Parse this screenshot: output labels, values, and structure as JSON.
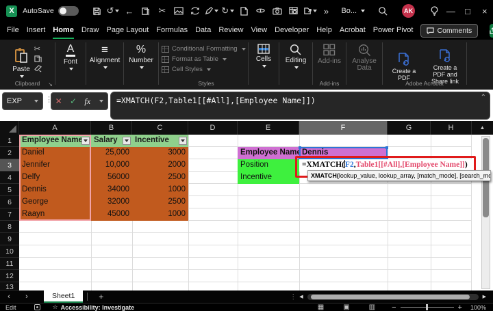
{
  "titlebar": {
    "autosave_label": "AutoSave",
    "doc_title": "Bo...",
    "avatar_initials": "AK"
  },
  "ribbon_tabs": {
    "items": [
      {
        "label": "File"
      },
      {
        "label": "Insert"
      },
      {
        "label": "Home"
      },
      {
        "label": "Draw"
      },
      {
        "label": "Page Layout"
      },
      {
        "label": "Formulas"
      },
      {
        "label": "Data"
      },
      {
        "label": "Review"
      },
      {
        "label": "View"
      },
      {
        "label": "Developer"
      },
      {
        "label": "Help"
      },
      {
        "label": "Acrobat"
      },
      {
        "label": "Power Pivot"
      }
    ],
    "comments_label": "Comments"
  },
  "ribbon": {
    "paste": "Paste",
    "clipboard_group": "Clipboard",
    "font": "Font",
    "alignment": "Alignment",
    "number": "Number",
    "conditional_formatting": "Conditional Formatting",
    "format_as_table": "Format as Table",
    "cell_styles": "Cell Styles",
    "styles_group": "Styles",
    "cells": "Cells",
    "editing": "Editing",
    "addins": "Add-ins",
    "addins_group": "Add-ins",
    "analyse_data": "Analyse Data",
    "create_pdf": "Create a PDF",
    "create_pdf_share": "Create a PDF and Share link",
    "acrobat_group": "Adobe Acrobat"
  },
  "formula_bar": {
    "name_box": "EXP",
    "fx": "fx",
    "formula": "=XMATCH(F2,Table1[[#All],[Employee Name]])"
  },
  "sheet": {
    "col_labels": [
      "A",
      "B",
      "C",
      "D",
      "E",
      "F",
      "G",
      "H"
    ],
    "row_labels": [
      "1",
      "2",
      "3",
      "4",
      "5",
      "6",
      "7",
      "8",
      "9",
      "10",
      "11",
      "12",
      "13"
    ],
    "table": {
      "headers": [
        "Employee Name",
        "Salary",
        "Incentive"
      ],
      "rows": [
        {
          "name": "Daniel",
          "salary": "25,000",
          "incentive": "3000"
        },
        {
          "name": "Jennifer",
          "salary": "10,000",
          "incentive": "2000"
        },
        {
          "name": "Delfy",
          "salary": "56000",
          "incentive": "2500"
        },
        {
          "name": "Dennis",
          "salary": "34000",
          "incentive": "1000"
        },
        {
          "name": "George",
          "salary": "32000",
          "incentive": "2500"
        },
        {
          "name": "Raayn",
          "salary": "45000",
          "incentive": "1000"
        }
      ]
    },
    "lookup": {
      "employee_label": "Employee Name",
      "employee_value": "Dennis",
      "position_label": "Position",
      "incentive_label": "Incentive"
    },
    "cell_formula": {
      "p1": "=XMATCH(",
      "p2": "F2",
      "p3": ",",
      "p4": "Table1[[#All],[Employee Name]]",
      "p5": ")"
    },
    "tooltip": {
      "fn": "XMATCH(",
      "args": "lookup_value, lookup_array, [match_mode], [search_mode])"
    }
  },
  "sheet_tabs": {
    "active": "Sheet1",
    "add": "+"
  },
  "status_bar": {
    "mode": "Edit",
    "accessibility": "Accessibility: Investigate",
    "zoom": "100%"
  },
  "colors": {
    "table_header_green": "#8FD08C",
    "table_row_orange": "#C15A1E",
    "lookup_magenta": "#CF70D2",
    "lookup_green": "#3EF03E",
    "annotation_red": "#E01B1B",
    "reference_blue": "#2E75D6",
    "reference_red": "#E3486B",
    "accent_green": "#21A366",
    "titlebar_bg": "#000000",
    "ribbon_bg": "#1B1B1B"
  }
}
